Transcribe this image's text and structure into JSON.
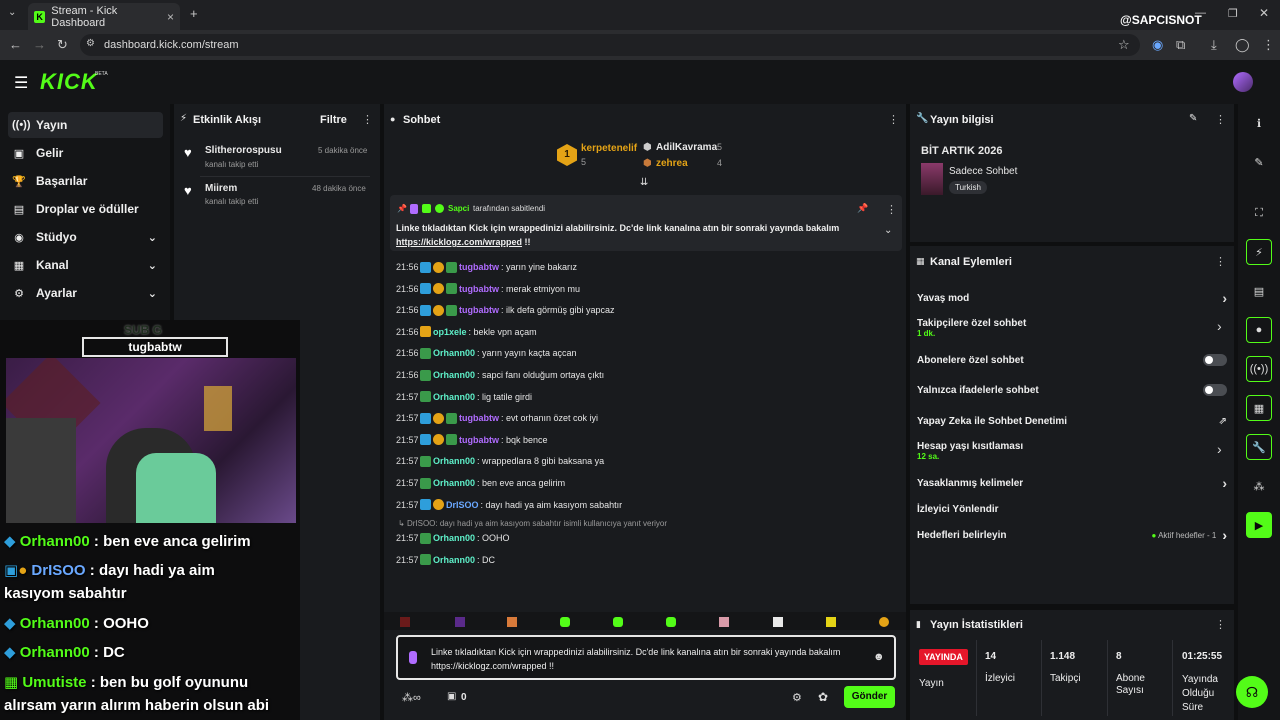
{
  "browser": {
    "tab_title": "Stream - Kick Dashboard",
    "tab_close": "×",
    "new_tab": "+",
    "url": "dashboard.kick.com/stream",
    "watermark": "@SAPCISNOT"
  },
  "app": {
    "logo": "KICK",
    "beta": "BETA"
  },
  "sidebar": {
    "items": [
      {
        "label": "Yayın",
        "icon": "broadcast-icon"
      },
      {
        "label": "Gelir",
        "icon": "revenue-icon"
      },
      {
        "label": "Başarılar",
        "icon": "trophy-icon"
      },
      {
        "label": "Droplar ve ödüller",
        "icon": "gift-icon"
      },
      {
        "label": "Stüdyo",
        "icon": "studio-icon"
      },
      {
        "label": "Kanal",
        "icon": "channel-icon"
      },
      {
        "label": "Ayarlar",
        "icon": "gear-icon"
      }
    ]
  },
  "activity": {
    "title": "Etkinlik Akışı",
    "filter": "Filtre",
    "items": [
      {
        "user": "Slitherorospusu",
        "action": "kanalı takip etti",
        "time": "5 dakika önce"
      },
      {
        "user": "Miirem",
        "action": "kanalı takip etti",
        "time": "48 dakika önce"
      }
    ]
  },
  "cam_overlay": {
    "sub_label": "SUB G",
    "name": "tugbabtw"
  },
  "overlay_chat": [
    {
      "user": "Orhann00",
      "text": " : ben eve anca gelirim"
    },
    {
      "user": "DrISOO",
      "text": " : dayı hadi ya aim"
    },
    {
      "user": "",
      "text": "kasıyom sabahtır"
    },
    {
      "user": "Orhann00",
      "text": " : OOHO"
    },
    {
      "user": "Orhann00",
      "text": " : DC"
    },
    {
      "user": "Umutiste",
      "text": " : ben bu golf oyununu"
    },
    {
      "user": "",
      "text": "alırsam yarın alırım haberin olsun abi"
    }
  ],
  "chat": {
    "title": "Sohbet",
    "gifters": [
      {
        "rank": "1",
        "name": "kerpetenelif",
        "count": "5"
      },
      {
        "name": "AdilKavrama",
        "count": "5"
      },
      {
        "name": "zehrea",
        "count": "4"
      }
    ],
    "pinned_by": "Sapci",
    "pinned_suffix": "tarafından sabitlendi",
    "pinned_text": "Linke tıkladıktan Kick için wrappedinizi alabilirsiniz. Dc'de link kanalına atın bir sonraki yayında bakalım",
    "pinned_link": "https://kicklogz.com/wrapped",
    "pinned_tail": " !!",
    "messages": [
      {
        "time": "21:56",
        "user": "tugbabtw",
        "text": ": yarın yine bakarız",
        "color": "purple",
        "badges": [
          "sub",
          "coin",
          "gift"
        ]
      },
      {
        "time": "21:56",
        "user": "tugbabtw",
        "text": ": merak etmiyon mu",
        "color": "purple",
        "badges": [
          "sub",
          "coin",
          "gift"
        ]
      },
      {
        "time": "21:56",
        "user": "tugbabtw",
        "text": ": ilk defa görmüş gibi yapcaz",
        "color": "purple",
        "badges": [
          "sub",
          "coin",
          "gift"
        ]
      },
      {
        "time": "21:56",
        "user": "op1xele",
        "text": ": bekle vpn açam",
        "color": "teal",
        "badges": [
          "crown"
        ]
      },
      {
        "time": "21:56",
        "user": "Orhann00",
        "text": ": yarın yayın kaçta açcan",
        "color": "teal",
        "badges": [
          "gift"
        ]
      },
      {
        "time": "21:56",
        "user": "Orhann00",
        "text": ": sapci fanı olduğum ortaya çıktı",
        "color": "teal",
        "badges": [
          "gift"
        ]
      },
      {
        "time": "21:57",
        "user": "Orhann00",
        "text": ": lig tatile girdi",
        "color": "teal",
        "badges": [
          "gift"
        ]
      },
      {
        "time": "21:57",
        "user": "tugbabtw",
        "text": ": evt orhanın özet cok iyi",
        "color": "purple",
        "badges": [
          "sub",
          "coin",
          "gift"
        ]
      },
      {
        "time": "21:57",
        "user": "tugbabtw",
        "text": ": bqk bence",
        "color": "purple",
        "badges": [
          "sub",
          "coin",
          "gift"
        ]
      },
      {
        "time": "21:57",
        "user": "Orhann00",
        "text": ": wrappedlara 8 gibi baksana ya",
        "color": "teal",
        "badges": [
          "gift"
        ]
      },
      {
        "time": "21:57",
        "user": "Orhann00",
        "text": ": ben eve anca gelirim",
        "color": "teal",
        "badges": [
          "gift"
        ]
      },
      {
        "time": "21:57",
        "user": "DrISOO",
        "text": ": dayı hadi ya aim kasıyom sabahtır",
        "color": "blue",
        "badges": [
          "sub",
          "coin"
        ]
      }
    ],
    "reply_hint": "DrISOO: dayı hadi ya aim kasıyom sabahtır isimli kullanıcıya yanıt veriyor",
    "messages2": [
      {
        "time": "21:57",
        "user": "Orhann00",
        "text": ": OOHO",
        "color": "teal",
        "badges": [
          "gift"
        ]
      },
      {
        "time": "21:57",
        "user": "Orhann00",
        "text": ": DC",
        "color": "teal",
        "badges": [
          "gift"
        ]
      }
    ],
    "input_value": "Linke tıkladıktan Kick için wrappedinizi alabilirsiniz. Dc'de link kanalına atın bir sonraki yayında bakalım https://kicklogz.com/wrapped !!",
    "points": "0",
    "send": "Gönder"
  },
  "stream_info": {
    "title": "Yayın bilgisi",
    "stream_title": "BİT ARTIK 2026",
    "category": "Sadece Sohbet",
    "tag": "Turkish"
  },
  "channel_actions": {
    "title": "Kanal Eylemleri",
    "items": [
      {
        "label": "Yavaş mod",
        "sub": "",
        "control": "arrow"
      },
      {
        "label": "Takipçilere özel sohbet",
        "sub": "1 dk.",
        "control": "arrow"
      },
      {
        "label": "Abonelere özel sohbet",
        "sub": "",
        "control": "toggle"
      },
      {
        "label": "Yalnızca ifadelerle sohbet",
        "sub": "",
        "control": "toggle"
      },
      {
        "label": "Yapay Zeka ile Sohbet Denetimi",
        "sub": "",
        "control": "external"
      },
      {
        "label": "Hesap yaşı kısıtlaması",
        "sub": "12 sa.",
        "control": "arrow"
      },
      {
        "label": "Yasaklanmış kelimeler",
        "sub": "",
        "control": "arrow"
      },
      {
        "label": "İzleyici Yönlendir",
        "sub": "",
        "control": "none"
      },
      {
        "label": "Hedefleri belirleyin",
        "sub": "",
        "control": "arrow"
      }
    ],
    "goals_status": "Aktif hedefler - 1"
  },
  "stream_stats": {
    "title": "Yayın İstatistikleri",
    "live_badge": "YAYINDA",
    "live_label": "Yayın",
    "viewers": "14",
    "viewers_label": "İzleyici",
    "followers": "1.148",
    "followers_label": "Takipçi",
    "subs": "8",
    "subs_label": "Abone Sayısı",
    "uptime": "01:25:55",
    "uptime_label": "Yayında Olduğu Süre"
  },
  "colors": {
    "brand": "#53fc18",
    "live": "#e5162a",
    "panel": "#191b1e"
  }
}
